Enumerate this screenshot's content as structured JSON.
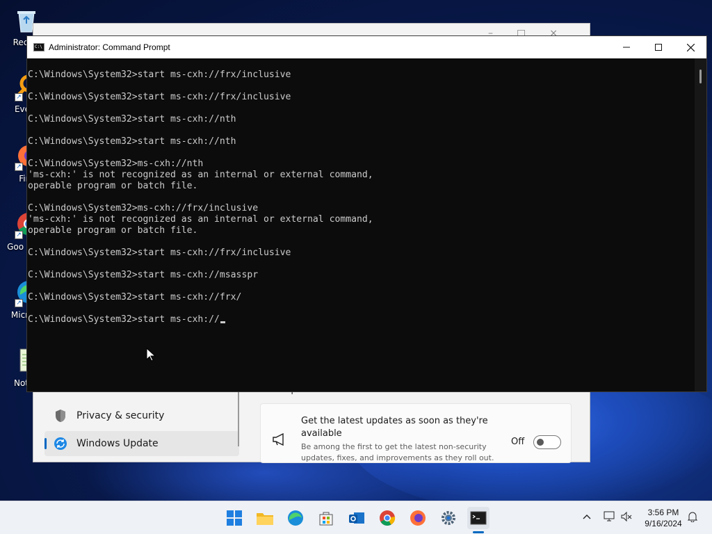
{
  "desktop": {
    "icons": [
      {
        "label": "Recycl",
        "icon": "recycle-bin-icon"
      },
      {
        "label": "Every",
        "icon": "everything-icon"
      },
      {
        "label": "Fire",
        "icon": "firefox-icon"
      },
      {
        "label": "Goo Chro",
        "icon": "chrome-icon"
      },
      {
        "label": "Micr Ed",
        "icon": "edge-icon"
      },
      {
        "label": "Notep",
        "icon": "notepad-icon"
      }
    ]
  },
  "settings": {
    "nav": [
      {
        "label": "Privacy & security",
        "icon": "shield-icon"
      },
      {
        "label": "Windows Update",
        "icon": "windows-update-icon"
      }
    ],
    "section_title": "More options",
    "card": {
      "title": "Get the latest updates as soon as they're available",
      "description": "Be among the first to get the latest non-security updates, fixes, and improvements as they roll out.",
      "state_label": "Off",
      "toggle_on": false
    }
  },
  "cmd": {
    "title": "Administrator: Command Prompt",
    "lines": [
      "C:\\Windows\\System32>start ms-cxh://frx/inclusive",
      "",
      "C:\\Windows\\System32>start ms-cxh://frx/inclusive",
      "",
      "C:\\Windows\\System32>start ms-cxh://nth",
      "",
      "C:\\Windows\\System32>start ms-cxh://nth",
      "",
      "C:\\Windows\\System32>ms-cxh://nth",
      "'ms-cxh:' is not recognized as an internal or external command,",
      "operable program or batch file.",
      "",
      "C:\\Windows\\System32>ms-cxh://frx/inclusive",
      "'ms-cxh:' is not recognized as an internal or external command,",
      "operable program or batch file.",
      "",
      "C:\\Windows\\System32>start ms-cxh://frx/inclusive",
      "",
      "C:\\Windows\\System32>start ms-cxh://msasspr",
      "",
      "C:\\Windows\\System32>start ms-cxh://frx/",
      ""
    ],
    "current_input": "C:\\Windows\\System32>start ms-cxh://"
  },
  "taskbar": {
    "apps": [
      "start-icon",
      "file-explorer-icon",
      "edge-icon",
      "store-icon",
      "outlook-icon",
      "chrome-icon",
      "firefox-icon",
      "settings-icon",
      "terminal-icon"
    ],
    "active_app": "terminal-icon",
    "time": "3:56 PM",
    "date": "9/16/2024"
  }
}
